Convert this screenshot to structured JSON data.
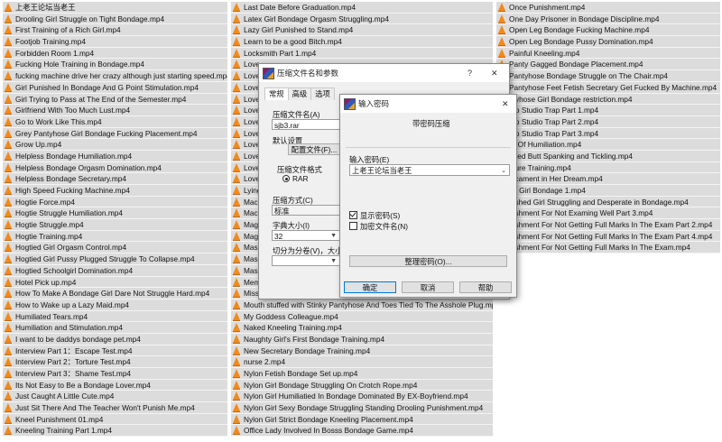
{
  "files": {
    "col1": [
      "上老王论坛当老王",
      "Drooling Girl Struggle on Tight Bondage.mp4",
      "First Training of a Rich Girl.mp4",
      "Footjob Training.mp4",
      "Forbidden Room 1.mp4",
      "Fucking Hole Training in Bondage.mp4",
      "fucking machine drive her crazy although just starting speed.mp4",
      "Girl Punished In Bondage And G Point Stimulation.mp4",
      "Girl Trying to Pass at The End of the Semester.mp4",
      "Girlfriend With Too Much Lust.mp4",
      "Go to Work Like This.mp4",
      "Grey Pantyhose Girl Bondage Fucking Placement.mp4",
      "Grow Up.mp4",
      "Helpless Bondage Humiliation.mp4",
      "Helpless Bondage Orgasm Domination.mp4",
      "Helpless Bondage Secretary.mp4",
      "High Speed Fucking Machine.mp4",
      "Hogtie Force.mp4",
      "Hogtie Struggle Humiliation.mp4",
      "Hogtie Struggle.mp4",
      "Hogtie Training.mp4",
      "Hogtied Girl Orgasm Control.mp4",
      "Hogtied Girl Pussy Plugged Struggle To Collapse.mp4",
      "Hogtied Schoolgirl Domination.mp4",
      "Hotel Pick up.mp4",
      "How To Make A Bondage Girl Dare Not Struggle Hard.mp4",
      "How to Wake up a Lazy Maid.mp4",
      "Humiliated Tears.mp4",
      "Humiliation and Stimulation.mp4",
      "I want to be daddys bondage pet.mp4",
      "Interview Part 1：Escape Test.mp4",
      "Interview Part 2：Torture Test.mp4",
      "Interview Part 3：Shame Test.mp4",
      "Its Not Easy to Be a Bondage Lover.mp4",
      "Just Caught A Little Cute.mp4",
      "Just Sit There And The Teacher Won't Punish Me.mp4",
      "Kneel Punishment 01.mp4",
      "Kneeling Training Part 1.mp4"
    ],
    "col2": [
      "Last Date Before Graduation.mp4",
      "Latex Girl Bondage Orgasm Struggling.mp4",
      "Lazy Girl Punished to Stand.mp4",
      "Learn to be a good Bitch.mp4",
      "Locksmith Part 1.mp4",
      "Love",
      "Love",
      "Love",
      "Love",
      "Love",
      "Love",
      "Love",
      "Love",
      "Love",
      "Love",
      "Love",
      "Lying",
      "Mac",
      "Mac",
      "Mag",
      "Mag",
      "Mas",
      "Mas",
      "Mas",
      "Mem",
      "Miss",
      "Mouth stuffed with Stinky Pantyhose And Toes Tied To The Asshole Plug.mp4",
      "My Goddess Colleague.mp4",
      "Naked Kneeling Training.mp4",
      "Naughty Girl's First Bondage Training.mp4",
      "New Secretary Bondage Training.mp4",
      "nurse 2.mp4",
      "Nylon Fetish Bondage Set up.mp4",
      "Nylon Girl Bondage Struggling On Crotch Rope.mp4",
      "Nylon Girl Humiliatied In Bondage Dominated By EX-Boyfriend.mp4",
      "Nylon Girl Sexy Bondage Struggling Standing Drooling Punishment.mp4",
      "Nylon Girl Strict Bondage Kneeling Placement.mp4",
      "Office Lady Involved In Bosss Bondage Game.mp4"
    ],
    "col3": [
      "Once Punishment.mp4",
      "One Day Prisoner in Bondage Discipline.mp4",
      "Open Leg Bondage Fucking Machine.mp4",
      "Open Leg Bondage Pussy Domination.mp4",
      "Painful Kneeling.mp4",
      "Panty Gagged Bondage Placement.mp4",
      "Pantyhose Bondage Struggle on The Chair.mp4",
      "Pantyhose Feet Fetish Secretary Get Fucked By Machine.mp4",
      "ntyhose Girl Bondage restriction.mp4",
      "oto Studio Trap Part 1.mp4",
      "oto Studio Trap Part 2.mp4",
      "oto Studio Trap Part 3.mp4",
      "er Of Humiliation.mp4",
      "gged Butt Spanking and Tickling.mp4",
      "sture Training.mp4",
      "dicament in Her Dream.mp4",
      "tty Girl Bondage 1.mp4",
      "nished Girl Struggling and Desperate in Bondage.mp4",
      "nishment For Not Examing Well Part 3.mp4",
      "nishment For Not Getting Full Marks In The Exam Part 2.mp4",
      "nishment For Not Getting Full Marks In The Exam Part 4.mp4",
      "nishment For Not Getting Full Marks In The Exam.mp4"
    ]
  },
  "params_dialog": {
    "title": "压缩文件名和参数",
    "help": "?",
    "close": "✕",
    "tabs": [
      "常规",
      "高级",
      "选项",
      "",
      "",
      "",
      ""
    ],
    "archive_name_label": "压缩文件名(A)",
    "archive_name_value": "sjb3.rar",
    "default_settings_label": "默认设置",
    "profile_button": "配置文件(F)...",
    "format_label": "压缩文件格式",
    "format_rar": "RAR",
    "method_label": "压缩方式(C)",
    "method_value": "标准",
    "dict_label": "字典大小(I)",
    "dict_value": "32",
    "split_label": "切分为分卷(V)，大小"
  },
  "password_dialog": {
    "title": "输入密码",
    "close": "✕",
    "heading": "带密码压缩",
    "input_label": "输入密码(E)",
    "input_value": "上老王论坛当老王",
    "show_password": "显示密码(S)",
    "encrypt_names": "加密文件名(N)",
    "organize_button": "整理密码(O)...",
    "ok": "确定",
    "cancel": "取消",
    "help": "帮助",
    "show_password_checked": true,
    "encrypt_names_checked": false
  }
}
